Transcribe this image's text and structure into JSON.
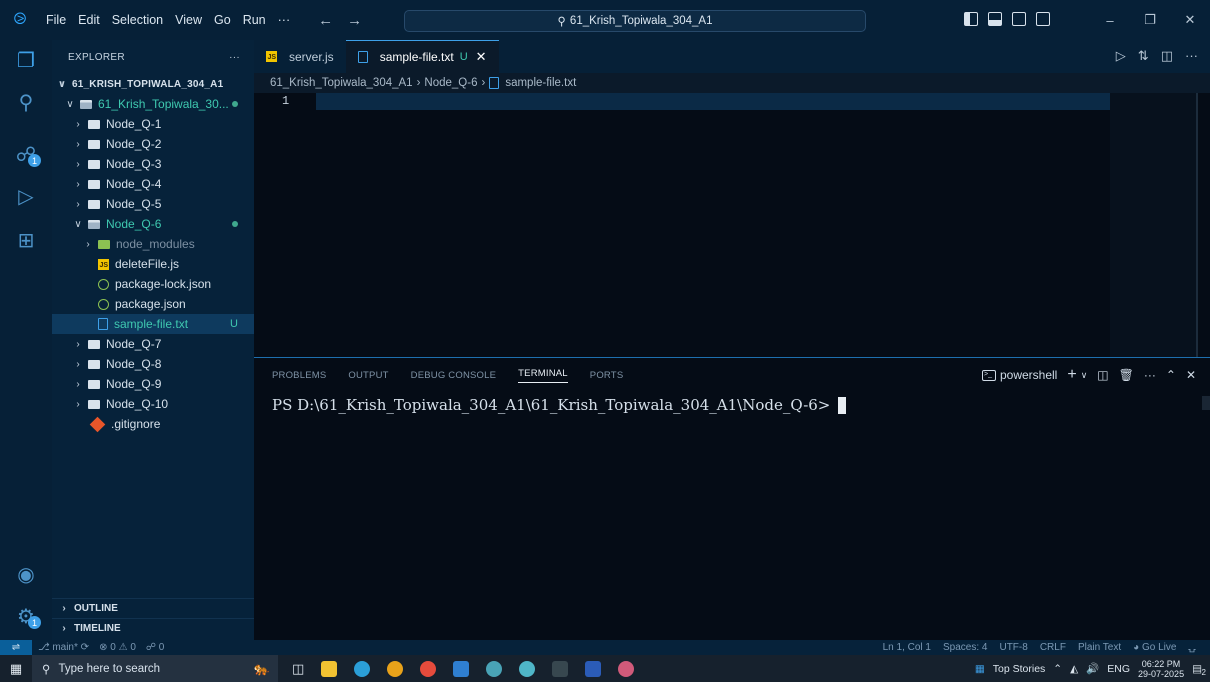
{
  "titlebar": {
    "menu": [
      "File",
      "Edit",
      "Selection",
      "View",
      "Go",
      "Run",
      "···"
    ],
    "search_text": "61_Krish_Topiwala_304_A1"
  },
  "sidebar": {
    "header": "EXPLORER",
    "root": "61_KRISH_TOPIWALA_304_A1",
    "project_folder": "61_Krish_Topiwala_30...",
    "folders_before": [
      "Node_Q-1",
      "Node_Q-2",
      "Node_Q-3",
      "Node_Q-4",
      "Node_Q-5"
    ],
    "open_folder": "Node_Q-6",
    "open_folder_items": {
      "node_modules": "node_modules",
      "delete_file": "deleteFile.js",
      "package_lock": "package-lock.json",
      "package": "package.json",
      "sample": "sample-file.txt",
      "sample_badge": "U"
    },
    "folders_after": [
      "Node_Q-7",
      "Node_Q-8",
      "Node_Q-9",
      "Node_Q-10"
    ],
    "gitignore": ".gitignore",
    "outline": "OUTLINE",
    "timeline": "TIMELINE"
  },
  "activity_bar": {
    "source_control_badge": "1",
    "accounts_badge": "1"
  },
  "tabs": [
    {
      "label": "server.js",
      "active": false
    },
    {
      "label": "sample-file.txt",
      "badge": "U",
      "active": true
    }
  ],
  "breadcrumb": {
    "root": "61_Krish_Topiwala_304_A1",
    "folder": "Node_Q-6",
    "file": "sample-file.txt"
  },
  "editor": {
    "line_number": "1"
  },
  "panel": {
    "tabs": [
      "PROBLEMS",
      "OUTPUT",
      "DEBUG CONSOLE",
      "TERMINAL",
      "PORTS"
    ],
    "active_tab": "TERMINAL",
    "shell": "powershell",
    "prompt": "PS D:\\61_Krish_Topiwala_304_A1\\61_Krish_Topiwala_304_A1\\Node_Q-6>"
  },
  "statusbar": {
    "branch": "main*",
    "errors": "0",
    "warnings": "0",
    "ports": "0",
    "cursor": "Ln 1, Col 1",
    "spaces": "Spaces: 4",
    "encoding": "UTF-8",
    "eol": "CRLF",
    "language": "Plain Text",
    "golive": "Go Live"
  },
  "taskbar": {
    "search_placeholder": "Type here to search",
    "news": "Top Stories",
    "lang": "ENG",
    "time": "06:22 PM",
    "date": "29-07-2025",
    "notif_count": "2"
  },
  "colors": {
    "accent": "#3ea0e8",
    "git_untracked": "#3fc9b0",
    "background": "#050c16"
  }
}
